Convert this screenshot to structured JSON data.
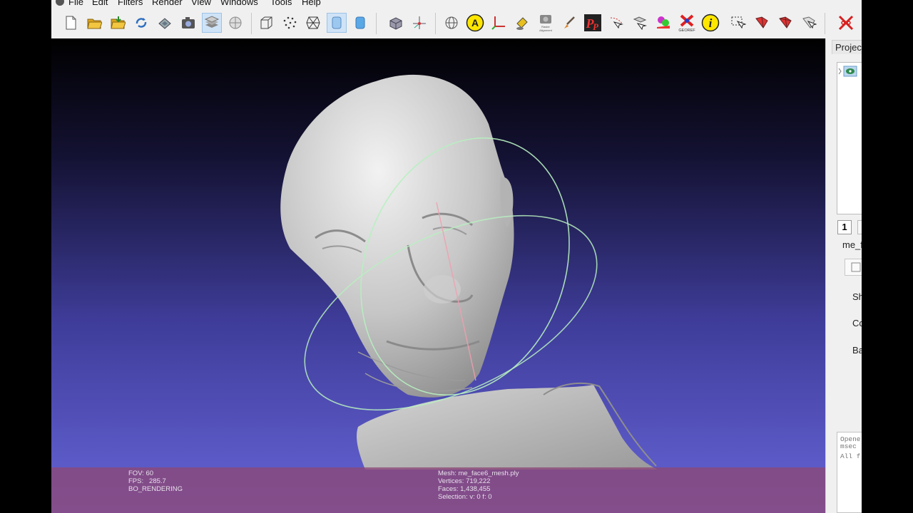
{
  "menu": [
    "File",
    "Edit",
    "Filters",
    "Render",
    "View",
    "Windows",
    "Tools",
    "Help"
  ],
  "toolbar_icons": [
    "new-project-icon",
    "open-project-icon",
    "import-mesh-icon",
    "reload-icon",
    "export-mesh-icon",
    "snapshot-icon",
    "layers-icon",
    "model-info-icon",
    "bounding-box-icon",
    "point-cloud-icon",
    "wireframe-icon",
    "flat-shading-icon",
    "smooth-shading-icon",
    "vertex-normals-icon",
    "axis-icon",
    "globe-icon",
    "annotation-icon",
    "measure-icon",
    "color-bucket-icon",
    "point-picking-icon",
    "paint-brush-icon",
    "pick-points-icon",
    "raster-align-icon",
    "align-tool-icon",
    "paint-color-icon",
    "georef-icon",
    "info-icon",
    "select-faces-icon",
    "select-vertices-icon",
    "select-conn-icon",
    "select-area-icon",
    "delete-icon"
  ],
  "toolbar_labels": {
    "raster_small": "Raster\nAlignment",
    "georef": "GEOREF",
    "annotation": "A",
    "info": "i",
    "pp": "P"
  },
  "overlay": {
    "fov": "FOV: 60",
    "fps_label": "FPS:",
    "fps_value": "285.7",
    "render_mode": "BO_RENDERING",
    "mesh": "Mesh: me_face6_mesh.ply",
    "vertices": "Vertices: 719,222",
    "faces": "Faces: 1,438,455",
    "selection": "Selection: v: 0 f: 0"
  },
  "right_panel": {
    "tab_label": "Project",
    "layer_number": "1",
    "layer_name": "me_f",
    "prop_sh": "Sh",
    "prop_co": "Co",
    "prop_ba": "Ba",
    "log_line1": "Opene",
    "log_line2": "msec",
    "log_line3": "All f"
  },
  "colors": {
    "bg_top": "#000000",
    "bg_bottom": "#6664d6",
    "overlay": "#8c4876",
    "mesh": "#c9c9c9",
    "trackball_green": "#b7f0c0",
    "trackball_red": "#f0a0b0"
  }
}
